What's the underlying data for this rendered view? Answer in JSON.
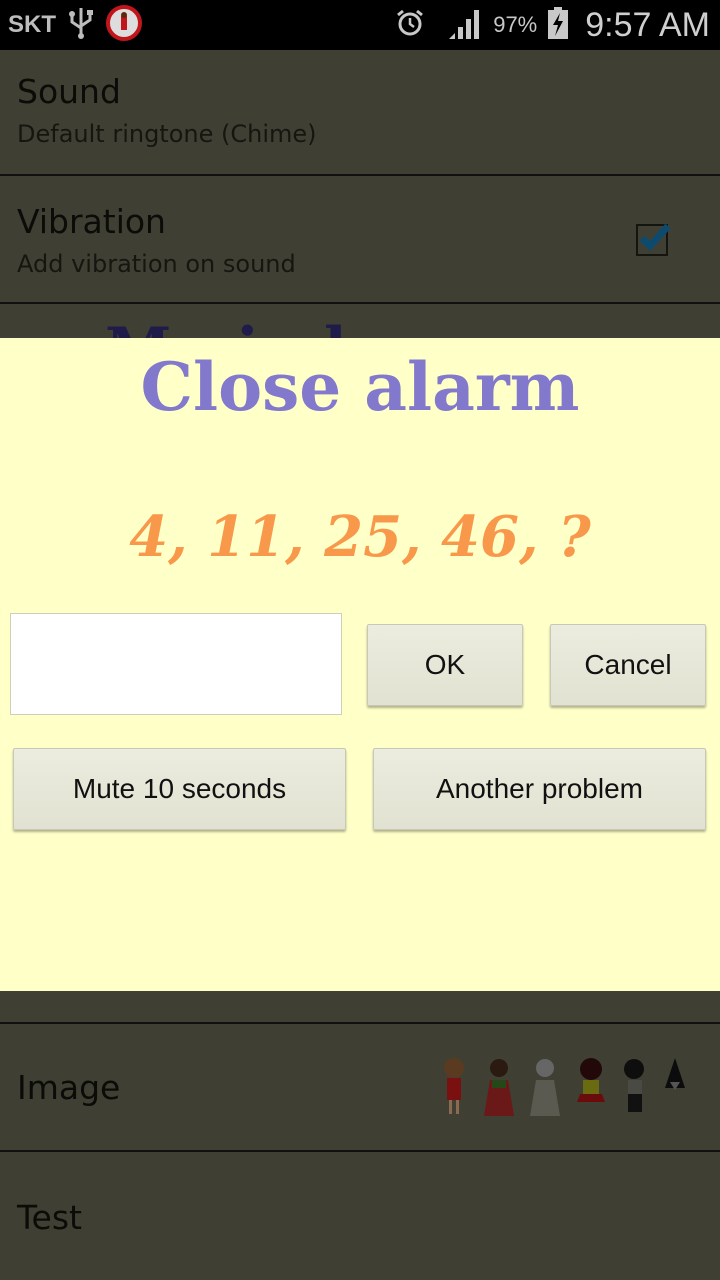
{
  "status_bar": {
    "carrier": "SKT",
    "usb_icon": "usb-icon",
    "app_icon": "clock-app-icon",
    "alarm_icon": "alarm-clock-icon",
    "signal_icon": "signal-icon",
    "battery_percent": "97%",
    "battery_icon": "battery-charging-icon",
    "time": "9:57 AM"
  },
  "settings": {
    "sound": {
      "title": "Sound",
      "subtitle": "Default ringtone (Chime)"
    },
    "vibration": {
      "title": "Vibration",
      "subtitle": "Add vibration on sound",
      "checked": true
    },
    "hidden_partial": "M i l",
    "image": {
      "title": "Image"
    },
    "test": {
      "title": "Test"
    }
  },
  "dialog": {
    "title": "Close alarm",
    "problem": "4, 11, 25, 46, ?",
    "answer_value": "",
    "ok_label": "OK",
    "cancel_label": "Cancel",
    "mute_label": "Mute 10 seconds",
    "another_label": "Another problem"
  },
  "colors": {
    "dialog_bg": "#ffffc8",
    "title": "#8278cc",
    "problem": "#f8984a",
    "checkbox_accent": "#0e4a6e"
  }
}
